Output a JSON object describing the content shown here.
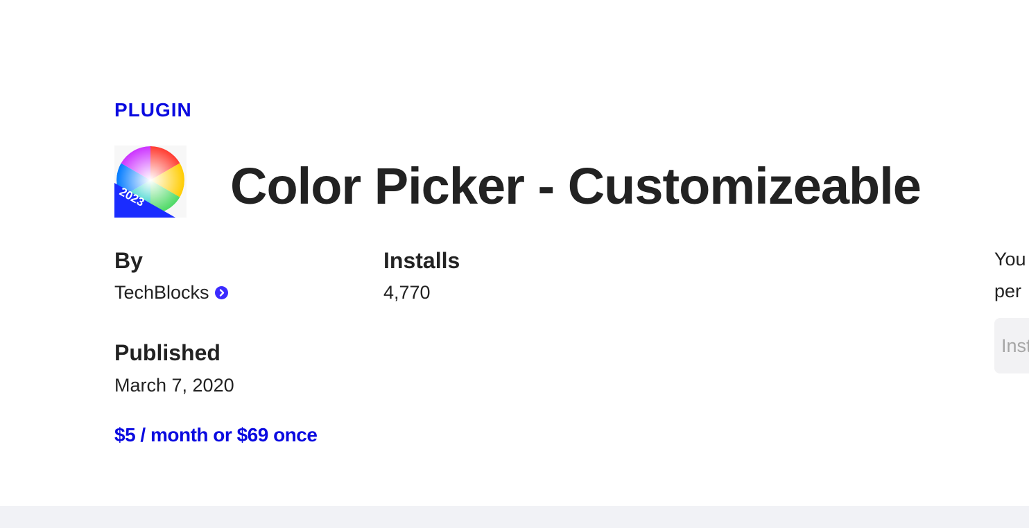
{
  "plugin": {
    "category": "PLUGIN",
    "title": "Color Picker - Customizeable",
    "icon": "color-wheel-icon",
    "icon_badge_text": "2023"
  },
  "meta": {
    "by_label": "By",
    "author": "TechBlocks",
    "installs_label": "Installs",
    "installs_value": "4,770",
    "published_label": "Published",
    "published_value": "March 7, 2020"
  },
  "price": "$5 / month or $69 once",
  "sidebar": {
    "line1": "You",
    "line2": "per",
    "input_placeholder": "Inst"
  },
  "colors": {
    "accent": "#0a0ae0",
    "text": "#222222",
    "verified_badge": "#3b2bff",
    "footer_band": "#f1f2f6"
  }
}
